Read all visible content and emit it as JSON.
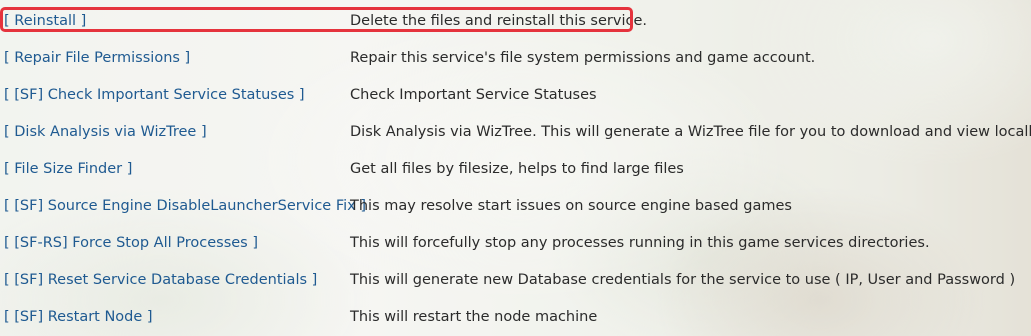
{
  "actions": [
    {
      "label": "[ Reinstall ]",
      "description": "Delete the files and reinstall this service."
    },
    {
      "label": "[ Repair File Permissions ]",
      "description": "Repair this service's file system permissions and game account."
    },
    {
      "label": "[ [SF] Check Important Service Statuses ]",
      "description": "Check Important Service Statuses"
    },
    {
      "label": "[ Disk Analysis via WizTree ]",
      "description": "Disk Analysis via WizTree. This will generate a WizTree file for you to download and view locally."
    },
    {
      "label": "[ File Size Finder ]",
      "description": "Get all files by filesize, helps to find large files"
    },
    {
      "label": "[ [SF] Source Engine DisableLauncherService Fix ]",
      "description": "This may resolve start issues on source engine based games"
    },
    {
      "label": "[ [SF-RS] Force Stop All Processes ]",
      "description": "This will forcefully stop any processes running in this game services directories."
    },
    {
      "label": "[ [SF] Reset Service Database Credentials ]",
      "description": "This will generate new Database credentials for the service to use ( IP, User and Password )"
    },
    {
      "label": "[ [SF] Restart Node ]",
      "description": "This will restart the node machine"
    }
  ],
  "colors": {
    "link": "#1f5a91",
    "text": "#2b2b2b",
    "highlight": "#e5333d"
  }
}
